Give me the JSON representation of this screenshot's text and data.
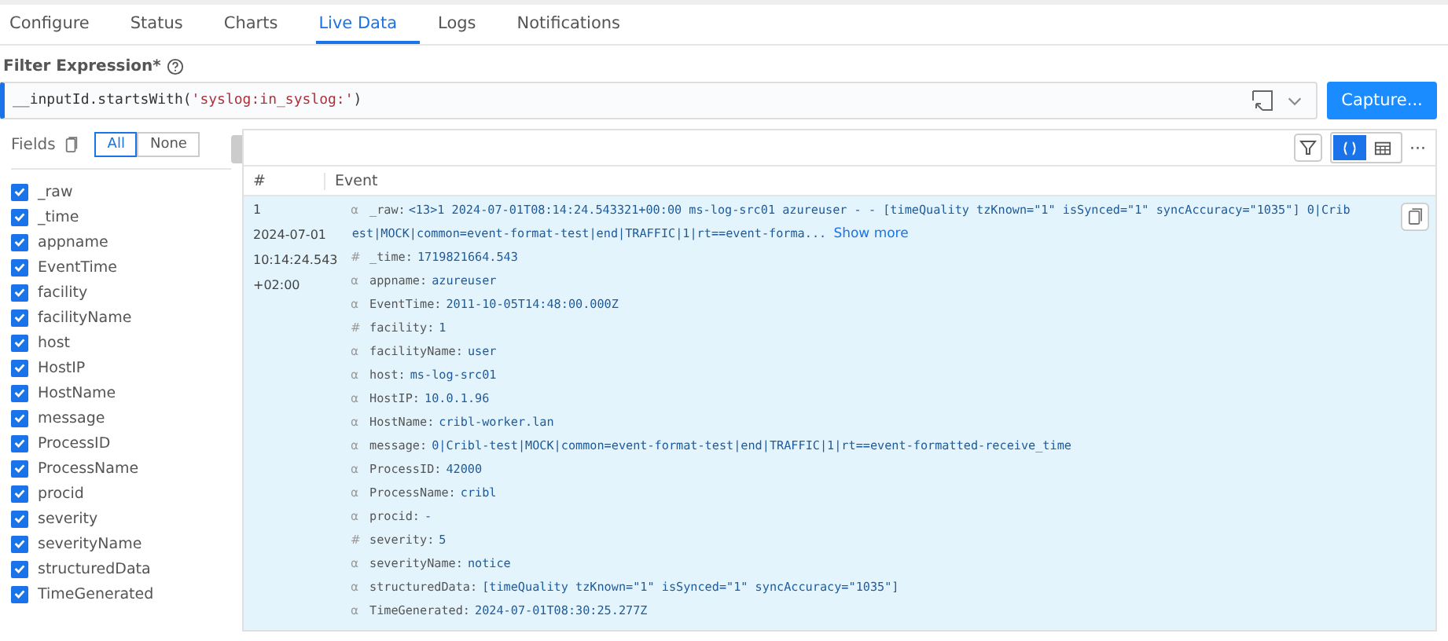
{
  "tabs": [
    {
      "label": "Configure",
      "selected": false
    },
    {
      "label": "Status",
      "selected": false
    },
    {
      "label": "Charts",
      "selected": false
    },
    {
      "label": "Live Data",
      "selected": true
    },
    {
      "label": "Logs",
      "selected": false
    },
    {
      "label": "Notifications",
      "selected": false
    }
  ],
  "filter": {
    "label": "Filter Expression*",
    "value_plain": "__inputId.startsWith(",
    "value_string": "'syslog:in_syslog:'",
    "value_end": ")",
    "button": "Capture..."
  },
  "fields_panel": {
    "title": "Fields",
    "toggles": [
      {
        "label": "All",
        "selected": true
      },
      {
        "label": "None",
        "selected": false
      }
    ],
    "fields": [
      {
        "name": "_raw",
        "checked": true
      },
      {
        "name": "_time",
        "checked": true
      },
      {
        "name": "appname",
        "checked": true
      },
      {
        "name": "EventTime",
        "checked": true
      },
      {
        "name": "facility",
        "checked": true
      },
      {
        "name": "facilityName",
        "checked": true
      },
      {
        "name": "host",
        "checked": true
      },
      {
        "name": "HostIP",
        "checked": true
      },
      {
        "name": "HostName",
        "checked": true
      },
      {
        "name": "message",
        "checked": true
      },
      {
        "name": "ProcessID",
        "checked": true
      },
      {
        "name": "ProcessName",
        "checked": true
      },
      {
        "name": "procid",
        "checked": true
      },
      {
        "name": "severity",
        "checked": true
      },
      {
        "name": "severityName",
        "checked": true
      },
      {
        "name": "structuredData",
        "checked": true
      },
      {
        "name": "TimeGenerated",
        "checked": true
      }
    ]
  },
  "table": {
    "columns": [
      "#",
      "Event"
    ],
    "rows": [
      {
        "index": "1",
        "date": "2024-07-01",
        "time": "10:14:24.543",
        "tz": "+02:00",
        "raw": {
          "type": "α",
          "key": "_raw:",
          "lines": [
            "<13>1 2024-07-01T08:14:24.543321+00:00 ms-log-src01 azureuser - - [timeQuality tzKnown=\"1\" isSynced=\"1\" syncAccuracy=\"1035\"] 0|Crib",
            "est|MOCK|common=event-format-test|end|TRAFFIC|1|rt==event-forma..."
          ],
          "more": "Show more"
        },
        "fields": [
          {
            "type": "#",
            "key": "_time:",
            "value": "1719821664.543"
          },
          {
            "type": "α",
            "key": "appname:",
            "value": "azureuser"
          },
          {
            "type": "α",
            "key": "EventTime:",
            "value": "2011-10-05T14:48:00.000Z"
          },
          {
            "type": "#",
            "key": "facility:",
            "value": "1"
          },
          {
            "type": "α",
            "key": "facilityName:",
            "value": "user"
          },
          {
            "type": "α",
            "key": "host:",
            "value": "ms-log-src01"
          },
          {
            "type": "α",
            "key": "HostIP:",
            "value": "10.0.1.96"
          },
          {
            "type": "α",
            "key": "HostName:",
            "value": "cribl-worker.lan"
          },
          {
            "type": "α",
            "key": "message:",
            "value": "0|Cribl-test|MOCK|common=event-format-test|end|TRAFFIC|1|rt==event-formatted-receive_time"
          },
          {
            "type": "α",
            "key": "ProcessID:",
            "value": "42000"
          },
          {
            "type": "α",
            "key": "ProcessName:",
            "value": "cribl"
          },
          {
            "type": "α",
            "key": "procid:",
            "value": "-"
          },
          {
            "type": "#",
            "key": "severity:",
            "value": "5"
          },
          {
            "type": "α",
            "key": "severityName:",
            "value": "notice"
          },
          {
            "type": "α",
            "key": "structuredData:",
            "value": "[timeQuality tzKnown=\"1\" isSynced=\"1\" syncAccuracy=\"1035\"]"
          },
          {
            "type": "α",
            "key": "TimeGenerated:",
            "value": "2024-07-01T08:30:25.277Z"
          }
        ]
      }
    ]
  },
  "view_modes": [
    {
      "kind": "json",
      "selected": true
    },
    {
      "kind": "table",
      "selected": false
    }
  ],
  "more_button": "···"
}
